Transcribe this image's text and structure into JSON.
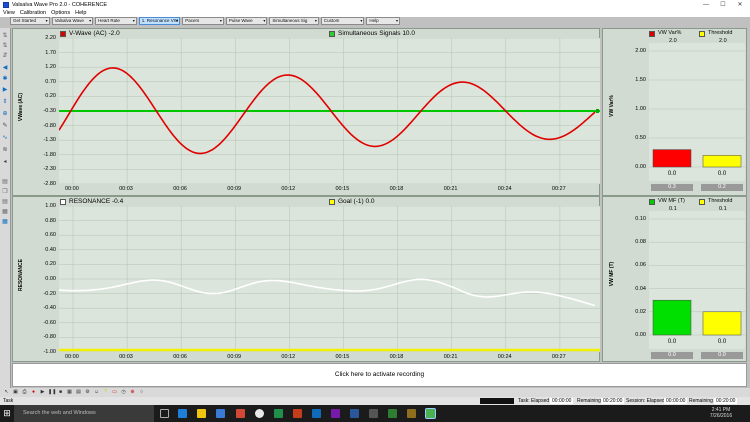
{
  "window": {
    "title": "Valsalva Wave Pro 2.0 - COHERENCE",
    "min": "—",
    "max": "☐",
    "close": "✕"
  },
  "menu": [
    "View",
    "Calibration",
    "Options",
    "Help"
  ],
  "tabs": [
    {
      "label": "Get Started",
      "active": false
    },
    {
      "label": "Valsalva Wave",
      "active": false
    },
    {
      "label": "Heart Rate",
      "active": false
    },
    {
      "label": "1. Resonance VW",
      "active": true
    },
    {
      "label": "Pacers",
      "active": false
    },
    {
      "label": "Pulse Wave",
      "active": false
    },
    {
      "label": "Simultaneous Sig",
      "active": false
    },
    {
      "label": "Custom",
      "active": false
    },
    {
      "label": "Help",
      "active": false
    }
  ],
  "vwave": {
    "title": "V-Wave (AC) -2.0",
    "signal_title": "Simultaneous Signals 10.0",
    "ylabel": "VWave (AC)",
    "yticks": [
      "2.20",
      "1.70",
      "1.20",
      "0.70",
      "0.20",
      "-0.30",
      "-0.80",
      "-1.30",
      "-1.80",
      "-2.30",
      "-2.80"
    ],
    "xticks": [
      "00:00",
      "00:03",
      "00:06",
      "00:09",
      "00:12",
      "00:15",
      "00:18",
      "00:21",
      "00:24",
      "00:27"
    ],
    "line_color": "#e00000",
    "baseline_color": "#00c800"
  },
  "resonance": {
    "title": "RESONANCE -0.4",
    "goal_title": "Goal (-1) 0.0",
    "ylabel": "RESONANCE",
    "yticks": [
      "1.00",
      "0.80",
      "0.60",
      "0.40",
      "0.20",
      "0.00",
      "-0.20",
      "-0.40",
      "-0.60",
      "-0.80",
      "-1.00"
    ],
    "xticks": [
      "00:00",
      "00:03",
      "00:06",
      "00:09",
      "00:12",
      "00:15",
      "00:18",
      "00:21",
      "00:24",
      "00:27"
    ],
    "line_color": "#ffffff",
    "goal_color": "#f0f000"
  },
  "vwvar": {
    "label1": "VW Var%",
    "val1": "2.0",
    "label2": "Threshold",
    "val2": "2.0",
    "ylabel": "VW Var%",
    "yticks": [
      "2.00",
      "1.50",
      "1.00",
      "0.50",
      "0.00"
    ],
    "bars": [
      {
        "value": 0.3,
        "label": "0.0",
        "footer": "0.3",
        "color": "#ff0000"
      },
      {
        "value": 0.2,
        "label": "0.0",
        "footer": "0.2",
        "color": "#ffff00"
      }
    ],
    "ymax": 2.0
  },
  "vwmf": {
    "label1": "VW MF (T)",
    "val1": "0.1",
    "label2": "Threshold",
    "val2": "0.1",
    "ylabel": "VW MF (T)",
    "yticks": [
      "0.10",
      "0.08",
      "0.06",
      "0.04",
      "0.02",
      "0.00"
    ],
    "bars": [
      {
        "value": 0.03,
        "label": "0.0",
        "footer": "0.0",
        "color": "#00e000"
      },
      {
        "value": 0.02,
        "label": "0.0",
        "footer": "0.0",
        "color": "#ffff00"
      }
    ],
    "ymax": 0.1
  },
  "record": {
    "label": "Click here to activate recording"
  },
  "status": {
    "task": "Task",
    "task_elapsed_label": "Task: Elapsed",
    "task_elapsed": "00:00:00",
    "remaining_label": "Remaining",
    "remaining": "00:20:00",
    "session_label": "Session: Elapsed",
    "session_elapsed": "00:00:00",
    "session_remaining_label": "Remaining",
    "session_remaining": "00:20:00"
  },
  "taskbar": {
    "search_placeholder": "Search the web and Windows",
    "time": "2:41 PM",
    "date": "7/26/2016"
  }
}
